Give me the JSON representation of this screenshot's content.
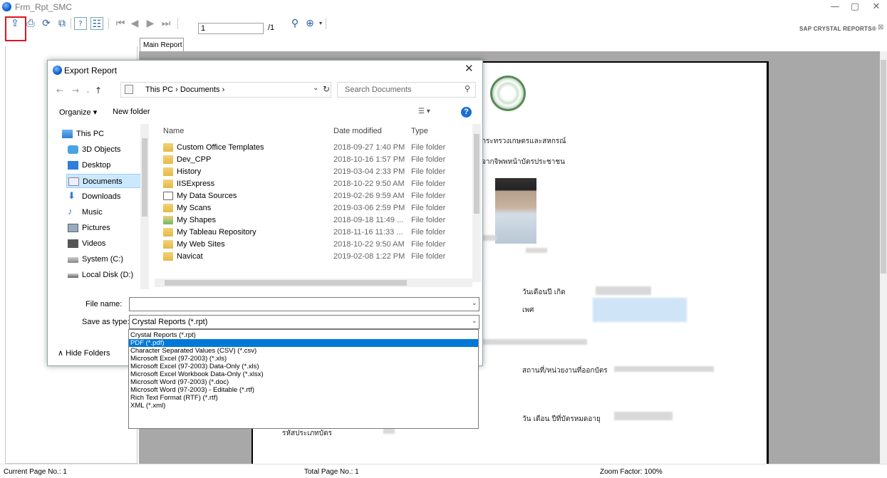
{
  "window": {
    "title": "Frm_Rpt_SMC"
  },
  "toolbar": {
    "page_value": "1",
    "page_total": "/1",
    "brand": "SAP CRYSTAL REPORTS®"
  },
  "tabs": {
    "main": "Main Report"
  },
  "dialog": {
    "title": "Export Report",
    "address": "This PC  ›  Documents  ›",
    "search_placeholder": "Search Documents",
    "organize": "Organize ▾",
    "new_folder": "New folder",
    "nav": [
      "This PC",
      "3D Objects",
      "Desktop",
      "Documents",
      "Downloads",
      "Music",
      "Pictures",
      "Videos",
      "System (C:)",
      "Local Disk (D:)"
    ],
    "columns": {
      "name": "Name",
      "date": "Date modified",
      "type": "Type"
    },
    "files": [
      {
        "name": "Custom Office Templates",
        "date": "2018-09-27 1:40 PM",
        "type": "File folder"
      },
      {
        "name": "Dev_CPP",
        "date": "2018-10-16 1:57 PM",
        "type": "File folder"
      },
      {
        "name": "History",
        "date": "2019-03-04 2:33 PM",
        "type": "File folder"
      },
      {
        "name": "IISExpress",
        "date": "2018-10-22 9:50 AM",
        "type": "File folder"
      },
      {
        "name": "My Data Sources",
        "date": "2019-02-26 9:59 AM",
        "type": "File folder"
      },
      {
        "name": "My Scans",
        "date": "2019-03-06 2:59 PM",
        "type": "File folder"
      },
      {
        "name": "My Shapes",
        "date": "2018-09-18 11:49 ...",
        "type": "File folder"
      },
      {
        "name": "My Tableau Repository",
        "date": "2018-11-16 11:33 ...",
        "type": "File folder"
      },
      {
        "name": "My Web Sites",
        "date": "2018-10-22 9:50 AM",
        "type": "File folder"
      },
      {
        "name": "Navicat",
        "date": "2019-02-08 1:22 PM",
        "type": "File folder"
      }
    ],
    "file_name_label": "File name:",
    "file_name_value": "",
    "save_type_label": "Save as type:",
    "save_type_value": "Crystal Reports (*.rpt)",
    "hide_folders": "Hide Folders",
    "save_type_options": [
      "Crystal Reports (*.rpt)",
      "PDF (*.pdf)",
      "Character Separated Values (CSV) (*.csv)",
      "Microsoft Excel (97-2003) (*.xls)",
      "Microsoft Excel (97-2003) Data-Only (*.xls)",
      "Microsoft Excel Workbook Data-Only (*.xlsx)",
      "Microsoft Word (97-2003) (*.doc)",
      "Microsoft Word (97-2003) - Editable (*.rtf)",
      "Rich Text Format (RTF) (*.rtf)",
      "XML (*.xml)"
    ],
    "selected_option_index": 1
  },
  "report": {
    "line1": "กระทรวงเกษตรและสหกรณ์",
    "line2": "จากจิพพหน้าบัตรประชาชน",
    "dob_label": "วันเดือนปี เกิด",
    "sex_label": "เพศ",
    "issuer_label": "สถานที่/หน่วยงานที่ออกบัตร",
    "expiry_label": "วัน เดือน ปีที่บัตรหมดอายุ",
    "card_code_label": "รหัสประเภทบัตร"
  },
  "status": {
    "current_page": "Current Page No.: 1",
    "total_page": "Total Page No.: 1",
    "zoom": "Zoom Factor: 100%"
  },
  "colors": {
    "accent": "#0078d7",
    "highlight": "#e0141e"
  }
}
